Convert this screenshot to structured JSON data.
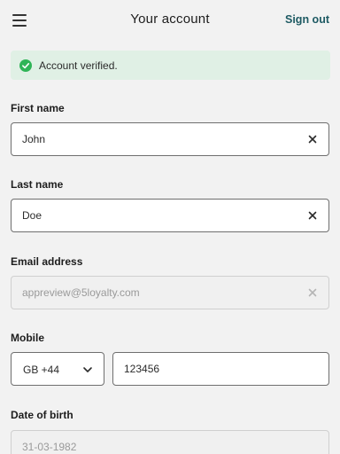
{
  "header": {
    "title": "Your account",
    "sign_out_label": "Sign out",
    "menu_icon": "hamburger-menu-icon"
  },
  "banner": {
    "text": "Account verified.",
    "icon": "check-circle-icon",
    "accent_color": "#2fb457",
    "background_color": "#e0f0e5"
  },
  "form": {
    "first_name": {
      "label": "First name",
      "value": "John"
    },
    "last_name": {
      "label": "Last name",
      "value": "Doe"
    },
    "email": {
      "label": "Email address",
      "value": "appreview@5loyalty.com",
      "disabled": true
    },
    "mobile": {
      "label": "Mobile",
      "country_code": "GB +44",
      "number": "123456"
    },
    "dob": {
      "label": "Date of birth",
      "value": "31-03-1982",
      "disabled": true
    }
  },
  "colors": {
    "link": "#1e5a63",
    "border": "#6f6f6f",
    "page_background": "#f2f2f2"
  }
}
